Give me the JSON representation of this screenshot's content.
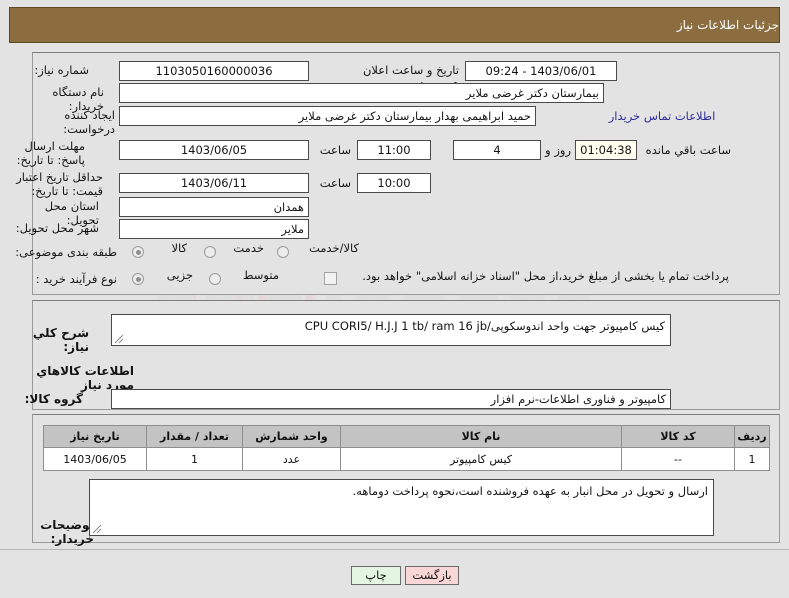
{
  "header": {
    "title": "جزئیات اطلاعات نیاز"
  },
  "watermark": {
    "text": "ariaTender",
    "suffix": ".net"
  },
  "form": {
    "need_number": {
      "label": "شماره نیاز:",
      "value": "1103050160000036"
    },
    "announce_datetime": {
      "label": "تاریخ و ساعت اعلان عمومی:",
      "value": "1403/06/01 - 09:24"
    },
    "buyer_org": {
      "label": "نام دستگاه خریدار:",
      "value": "بیمارستان دکتر غرضی ملایر"
    },
    "requester": {
      "label": "ایجاد کننده درخواست:",
      "value": "حمید ابراهیمی بهدار بیمارستان دکتر غرضی ملایر"
    },
    "contact_link": {
      "label": "اطلاعات تماس خریدار"
    },
    "reply_deadline": {
      "label": "مهلت ارسال پاسخ: تا تاریخ:",
      "date": "1403/06/05",
      "time_label": "ساعت",
      "time": "11:00",
      "days_value": "4",
      "days_label": "روز و",
      "countdown": "01:04:38",
      "remaining_label": "ساعت باقي مانده"
    },
    "price_validity": {
      "label": "حداقل تاریخ اعتبار قیمت: تا تاریخ:",
      "date": "1403/06/11",
      "time_label": "ساعت",
      "time": "10:00"
    },
    "province": {
      "label": "استان محل تحویل:",
      "value": "همدان"
    },
    "city": {
      "label": "شهر محل تحویل:",
      "value": "ملایر"
    },
    "subject_class": {
      "label": "طبقه بندی موضوعی:",
      "options": [
        {
          "label": "کالا",
          "selected": true
        },
        {
          "label": "خدمت",
          "selected": false
        },
        {
          "label": "کالا/خدمت",
          "selected": false
        }
      ]
    },
    "purchase_process": {
      "label": "نوع فرآیند خرید :",
      "options": [
        {
          "label": "جزیی",
          "selected": true
        },
        {
          "label": "متوسط",
          "selected": false
        }
      ]
    },
    "treasury_note": {
      "checked": false,
      "text": "پرداخت تمام یا بخشی از مبلغ خرید،از محل \"اسناد خزانه اسلامی\" خواهد بود."
    }
  },
  "description": {
    "label": "شرح کلي نیاز:",
    "value": "کیس کامپیوتر جهت واحد اندوسکوپی/CPU  CORI5/ H.J.J  1 tb/ ram 16 jb",
    "section_title": "اطلاعات کالاهاي مورد نیاز",
    "group_label": "گروه کالا:",
    "group_value": "کامپیوتر و فناوری اطلاعات-نرم افزار"
  },
  "items_table": {
    "columns": [
      "ردیف",
      "کد کالا",
      "نام کالا",
      "واحد شمارش",
      "تعداد / مقدار",
      "تاریخ نیاز"
    ],
    "rows": [
      {
        "row": "1",
        "code": "--",
        "name": "کیس کامپیوتر",
        "unit": "عدد",
        "qty": "1",
        "need_date": "1403/06/05"
      }
    ]
  },
  "buyer_notes": {
    "label": "توضیحات خریدار:",
    "value": "ارسال و تحویل در محل انبار به عهده فروشنده است،نحوه پرداخت دوماهه."
  },
  "buttons": {
    "print": "چاپ",
    "back": "بازگشت"
  },
  "colors": {
    "header_bg": "#8b6d40",
    "panel_bg": "#e3e3e3",
    "table_header_bg": "#c3c3c3",
    "print_btn_bg": "#e4f5e2",
    "back_btn_bg": "#f9d7d7",
    "link": "#2d2d9c",
    "countdown_bg": "#fffff0"
  }
}
